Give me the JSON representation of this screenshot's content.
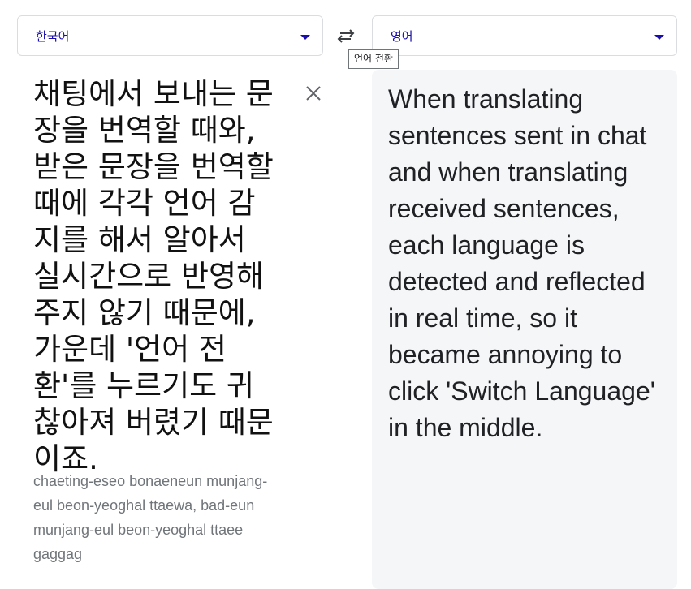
{
  "source_language": {
    "label": "한국어"
  },
  "target_language": {
    "label": "영어"
  },
  "swap": {
    "tooltip": "언어 전환"
  },
  "source": {
    "text": "채팅에서 보내는 문장을 번역할 때와, 받은 문장을 번역할 때에 각각 언어 감지를 해서 알아서 실시간으로 반영해주지 않기 때문에, 가운데 '언어 전환'를 누르기도 귀찮아져 버렸기 때문이죠.",
    "romanization": "chaeting-eseo bonaeneun munjang-eul beon-yeoghal ttaewa, bad-eun munjang-eul beon-yeoghal ttaee gaggag"
  },
  "translation": {
    "text": "When translating sentences sent in chat and when translating received sentences, each language is detected and reflected in real time, so it became annoying to click 'Switch Language' in the middle."
  },
  "colors": {
    "accent": "#1a0dab",
    "panel_bg": "#f5f6f8",
    "border": "#dadce0",
    "muted": "#70757a"
  }
}
